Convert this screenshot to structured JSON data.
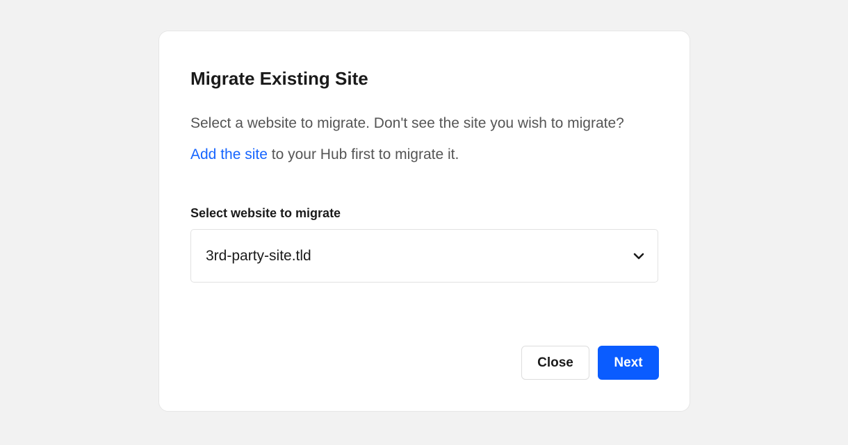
{
  "modal": {
    "title": "Migrate Existing Site",
    "description_main": "Select a website to migrate. Don't see the site you wish to migrate?",
    "description_link": "Add the site",
    "description_tail": " to your Hub first to migrate it.",
    "field_label": "Select website to migrate",
    "selected_site": "3rd-party-site.tld",
    "close_label": "Close",
    "next_label": "Next"
  },
  "colors": {
    "accent": "#0a5cff",
    "link": "#1665ff",
    "background": "#f2f2f2"
  },
  "icons": {
    "dropdown": "chevron-down-icon"
  }
}
